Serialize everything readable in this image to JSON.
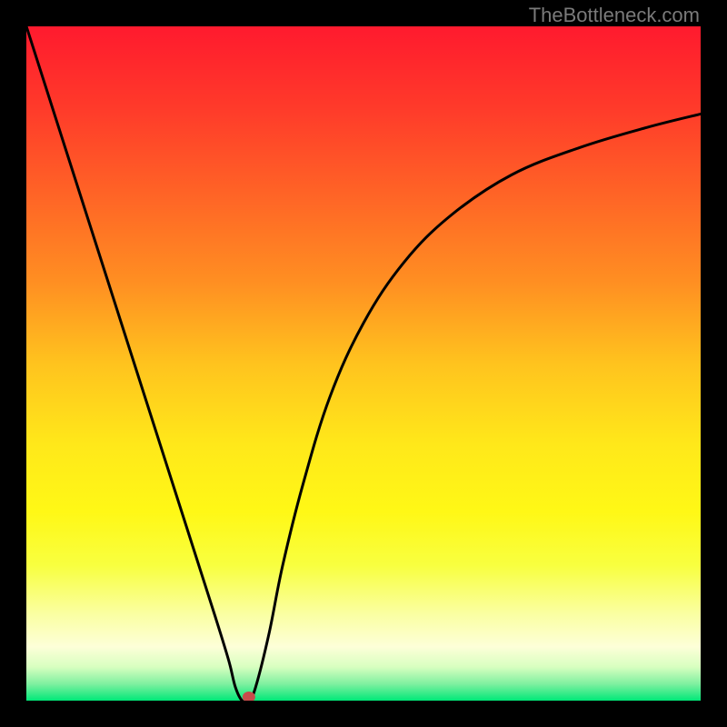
{
  "watermark": "TheBottleneck.com",
  "chart_data": {
    "type": "line",
    "title": "",
    "xlabel": "",
    "ylabel": "",
    "xlim": [
      0,
      100
    ],
    "ylim": [
      0,
      100
    ],
    "grid": false,
    "legend": false,
    "annotations": [
      {
        "name": "marker-dot",
        "x": 33,
        "y": 0,
        "color": "#c74b4b"
      }
    ],
    "background_gradient": {
      "stops": [
        {
          "pos": 0.0,
          "color": "#ff1a2e"
        },
        {
          "pos": 0.12,
          "color": "#ff3a2a"
        },
        {
          "pos": 0.25,
          "color": "#ff6426"
        },
        {
          "pos": 0.38,
          "color": "#ff8f22"
        },
        {
          "pos": 0.5,
          "color": "#ffc31e"
        },
        {
          "pos": 0.62,
          "color": "#ffe81a"
        },
        {
          "pos": 0.72,
          "color": "#fff816"
        },
        {
          "pos": 0.8,
          "color": "#f8ff40"
        },
        {
          "pos": 0.87,
          "color": "#faffa0"
        },
        {
          "pos": 0.92,
          "color": "#fdffd8"
        },
        {
          "pos": 0.95,
          "color": "#d8ffc0"
        },
        {
          "pos": 0.975,
          "color": "#80f0a0"
        },
        {
          "pos": 1.0,
          "color": "#00e878"
        }
      ]
    },
    "series": [
      {
        "name": "bottleneck-curve",
        "x": [
          0,
          4,
          8,
          12,
          16,
          20,
          24,
          28,
          30,
          31,
          32,
          33,
          34,
          36,
          38,
          41,
          45,
          50,
          56,
          63,
          72,
          82,
          92,
          100
        ],
        "values": [
          100,
          87.5,
          75,
          62.5,
          50,
          37.5,
          25,
          12.5,
          6,
          2,
          0,
          0,
          2,
          10,
          20,
          32,
          45,
          56,
          65,
          72,
          78,
          82,
          85,
          87
        ]
      }
    ]
  }
}
